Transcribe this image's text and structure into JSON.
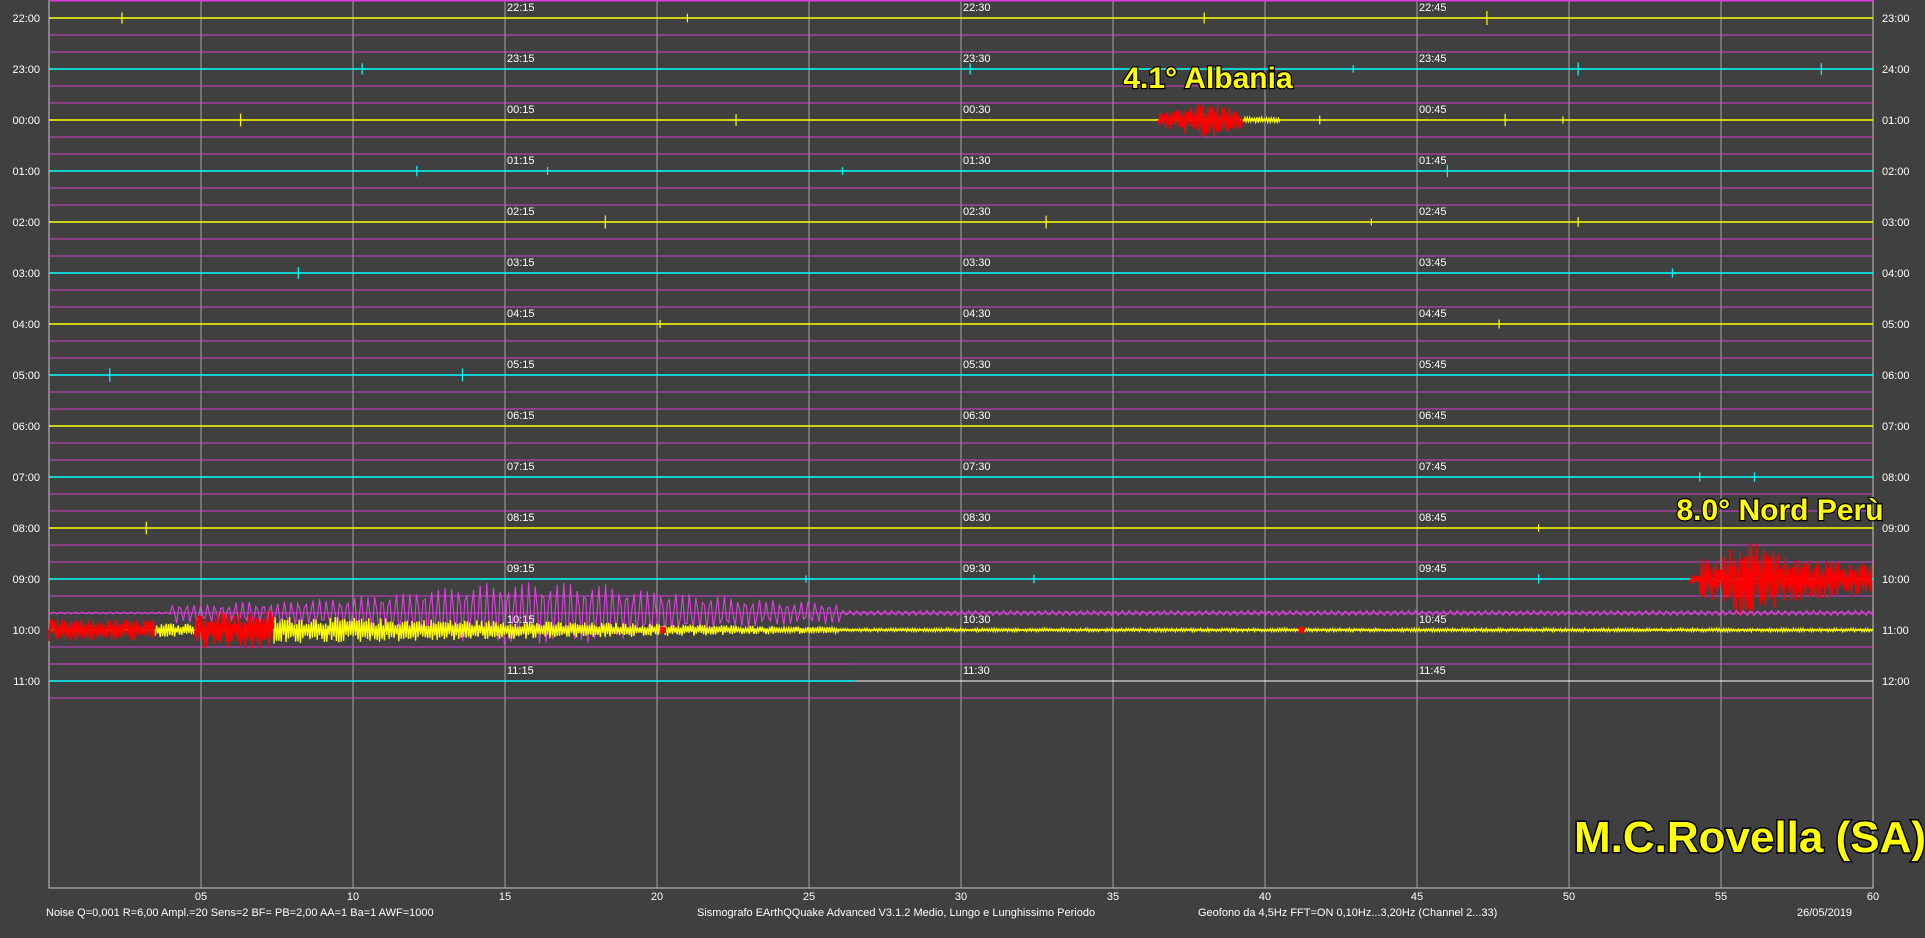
{
  "chart_data": {
    "type": "helicorder",
    "row_minutes": 60,
    "left_time_labels": [
      "22:00",
      "23:00",
      "00:00",
      "01:00",
      "02:00",
      "03:00",
      "04:00",
      "05:00",
      "06:00",
      "07:00",
      "08:00",
      "09:00",
      "10:00",
      "11:00"
    ],
    "right_time_labels": [
      "23:00",
      "24:00",
      "01:00",
      "02:00",
      "03:00",
      "04:00",
      "05:00",
      "06:00",
      "07:00",
      "08:00",
      "09:00",
      "10:00",
      "11:00",
      "12:00"
    ],
    "quarter_labels": [
      [
        "22:15",
        "22:30",
        "22:45"
      ],
      [
        "23:15",
        "23:30",
        "23:45"
      ],
      [
        "00:15",
        "00:30",
        "00:45"
      ],
      [
        "01:15",
        "01:30",
        "01:45"
      ],
      [
        "02:15",
        "02:30",
        "02:45"
      ],
      [
        "03:15",
        "03:30",
        "03:45"
      ],
      [
        "04:15",
        "04:30",
        "04:45"
      ],
      [
        "05:15",
        "05:30",
        "05:45"
      ],
      [
        "06:15",
        "06:30",
        "06:45"
      ],
      [
        "07:15",
        "07:30",
        "07:45"
      ],
      [
        "08:15",
        "08:30",
        "08:45"
      ],
      [
        "09:15",
        "09:30",
        "09:45"
      ],
      [
        "10:15",
        "10:30",
        "10:45"
      ],
      [
        "11:15",
        "11:30",
        "11:45"
      ]
    ],
    "trace_colors": [
      "#ffff00",
      "#00ffff"
    ],
    "event_color": "#ff0000",
    "long_period_color": "#e040e0",
    "x_ticks": [
      "05",
      "10",
      "15",
      "20",
      "25",
      "30",
      "35",
      "40",
      "45",
      "50",
      "55",
      "60"
    ],
    "xlim": [
      0,
      60
    ],
    "grid": true,
    "last_trace_end_minute": 26.5,
    "events": [
      {
        "label": "4.1° Albania",
        "row": 2,
        "start_minute": 36.5,
        "end_minute": 39.3,
        "peak_minute": 38.0
      },
      {
        "label": "8.0° Nord Perù",
        "row": 11,
        "start_minute": 54.0,
        "end_minute": 60.0,
        "peak_minute": 56.0
      },
      {
        "label": "",
        "row": 12,
        "start_minute": 0.0,
        "end_minute": 26.5,
        "peak_minute": 16.0
      }
    ]
  },
  "watermark": "M.C.Rovella (SA)",
  "footer": {
    "left": "Noise Q=0,001 R=6,00 Ampl.=20 Sens=2 BF= PB=2,00 AA=1 Ba=1 AWF=1000",
    "center": "Sismografo  EArthQQuake Advanced V3.1.2  Medio, Lungo e Lunghissimo Periodo",
    "right": "Geofono da 4,5Hz FFT=ON 0,10Hz...3,20Hz      (Channel 2...33)",
    "date": "26/05/2019"
  }
}
